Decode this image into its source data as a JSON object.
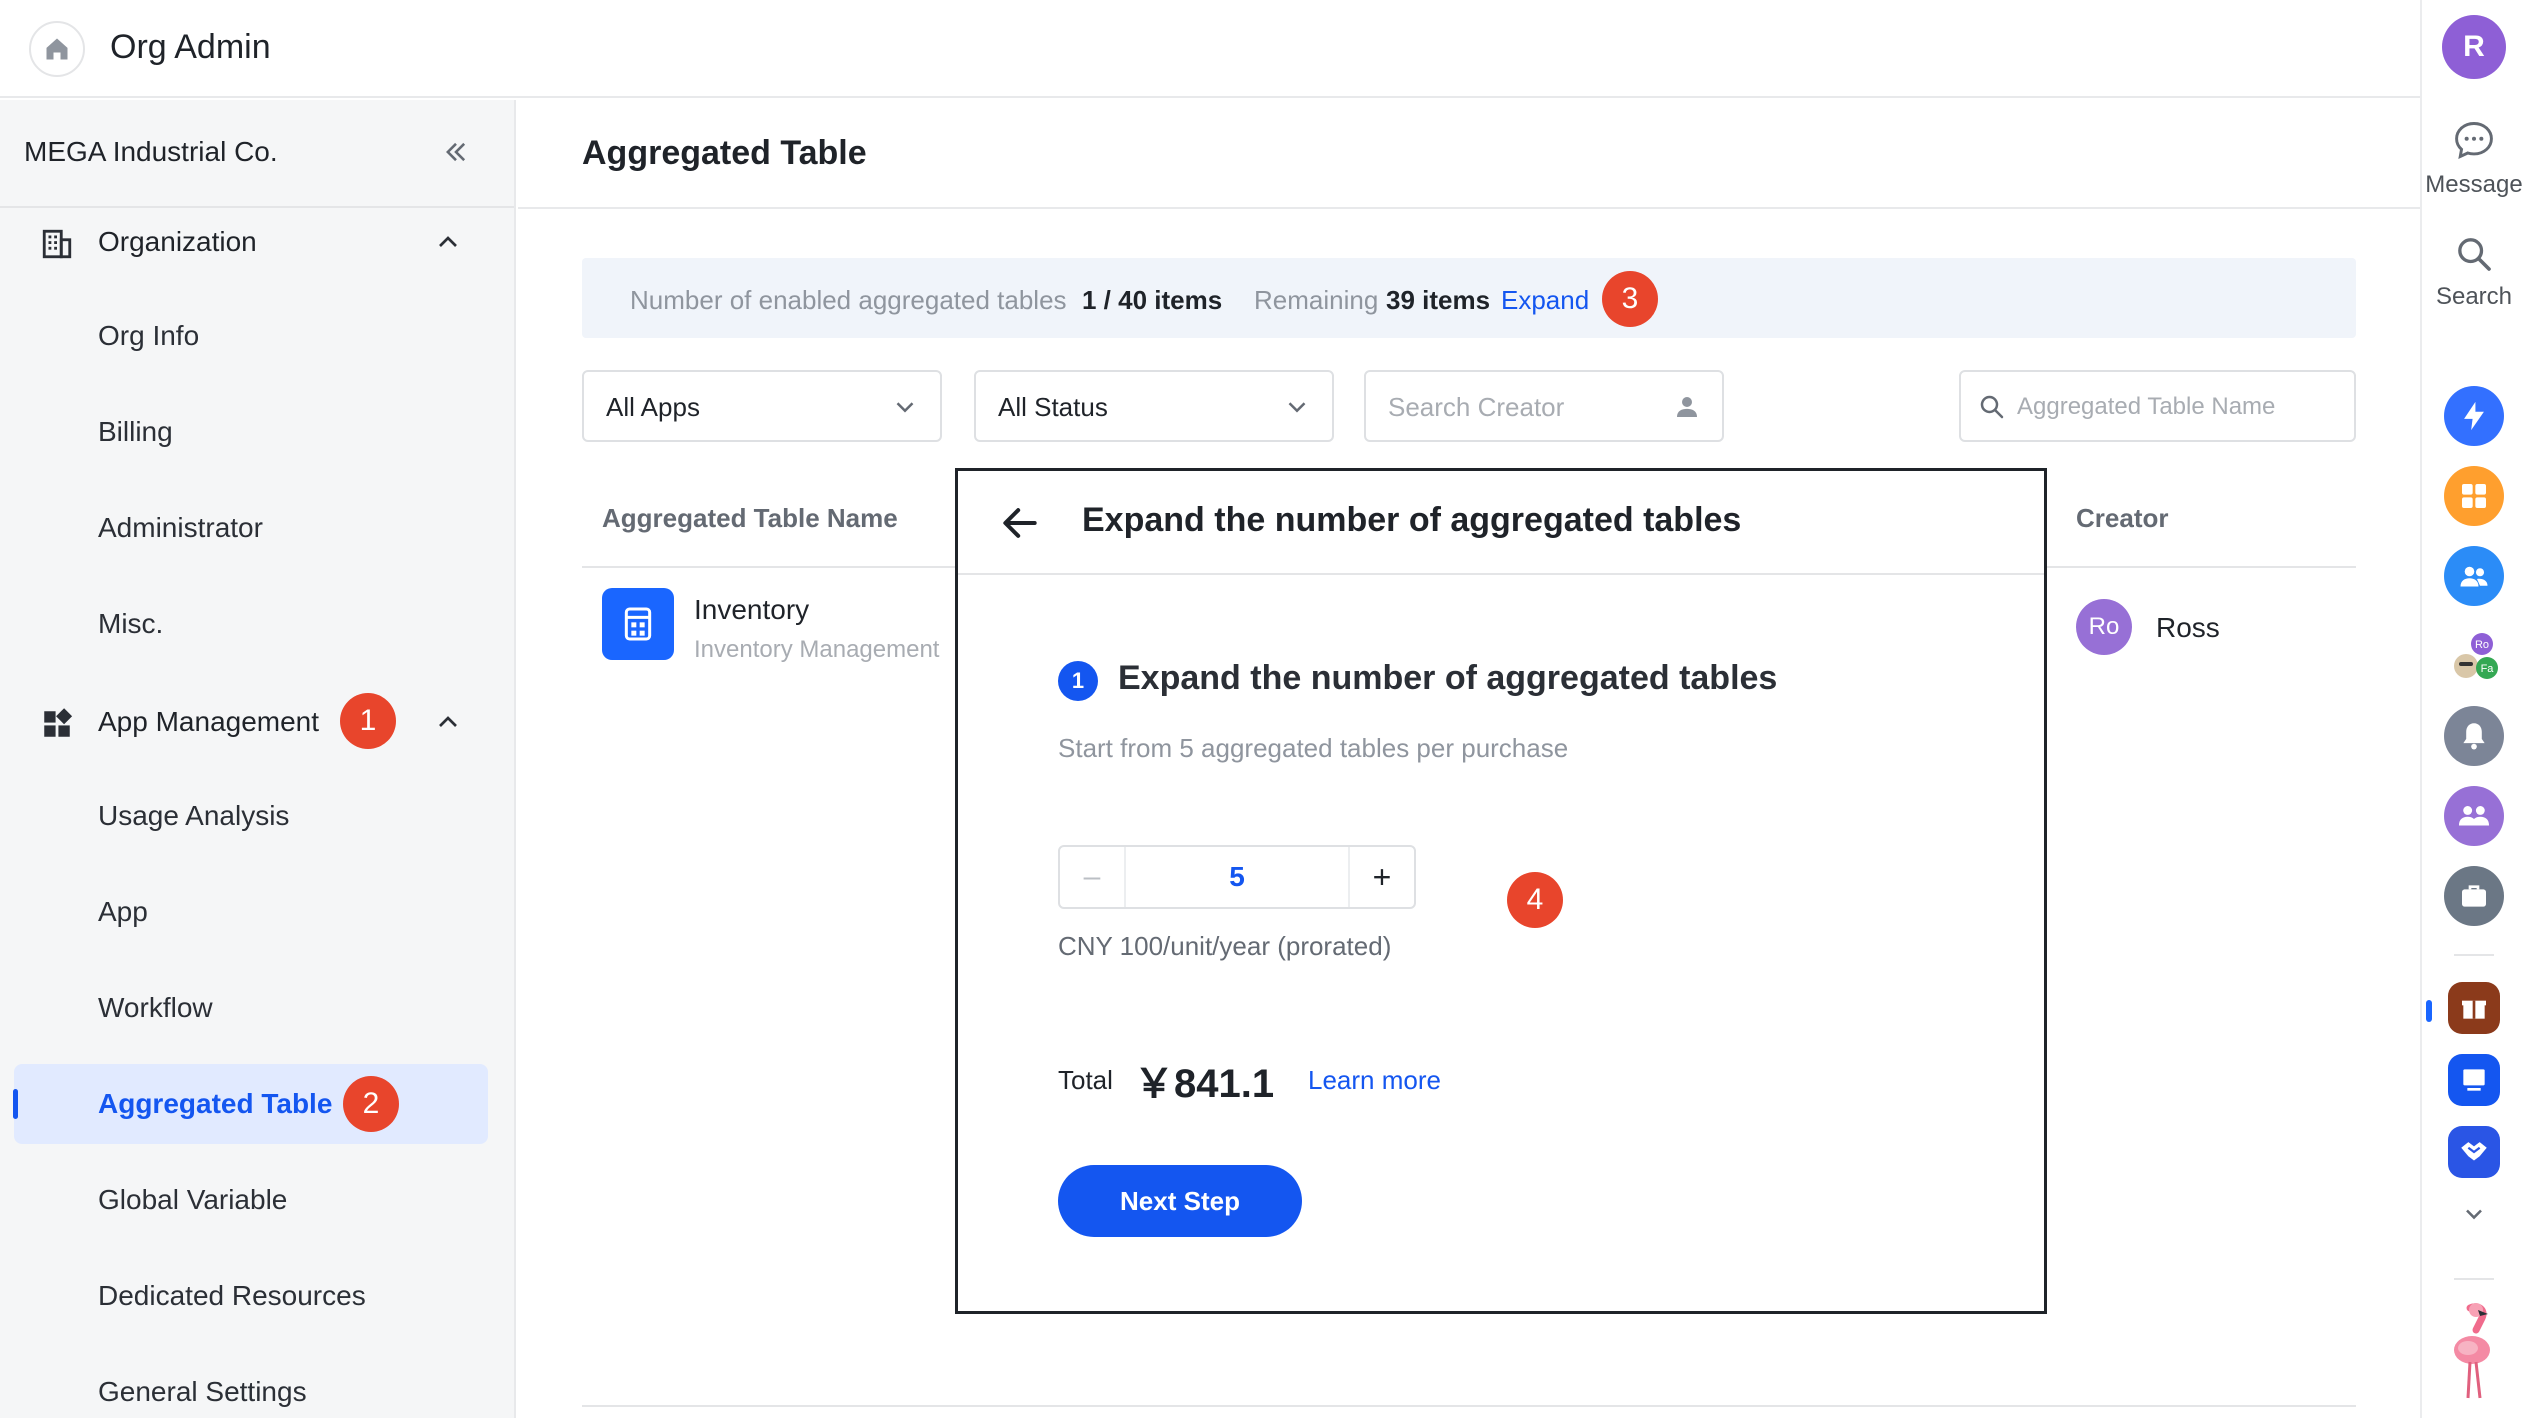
{
  "header": {
    "title": "Org Admin"
  },
  "rail": {
    "avatar": "R",
    "tools": [
      {
        "label": "Message"
      },
      {
        "label": "Search"
      }
    ],
    "badge_names": [
      "Ro",
      "Fa"
    ]
  },
  "sidebar": {
    "org_name": "MEGA Industrial Co.",
    "organization": {
      "label": "Organization",
      "items": [
        "Org Info",
        "Billing",
        "Administrator",
        "Misc."
      ]
    },
    "app_management": {
      "label": "App Management",
      "items": [
        "Usage Analysis",
        "App",
        "Workflow",
        "Aggregated Table",
        "Global Variable",
        "Dedicated Resources",
        "General Settings"
      ],
      "active": "Aggregated Table"
    }
  },
  "main": {
    "title": "Aggregated Table",
    "banner": {
      "enabled_label": "Number of enabled aggregated tables",
      "enabled_value": "1 / 40 items",
      "remaining_label": "Remaining",
      "remaining_value": "39 items",
      "expand_link": "Expand"
    },
    "filters": {
      "apps": "All Apps",
      "status": "All Status",
      "creator_placeholder": "Search Creator",
      "name_placeholder": "Aggregated Table Name"
    },
    "table": {
      "columns": {
        "name": "Aggregated Table Name",
        "creator": "Creator"
      },
      "rows": [
        {
          "name": "Inventory",
          "app": "Inventory Management",
          "creator_initials": "Ro",
          "creator": "Ross"
        }
      ]
    }
  },
  "dialog": {
    "title": "Expand the number of aggregated tables",
    "step_number": "1",
    "step_title": "Expand the number of aggregated tables",
    "step_desc": "Start from 5 aggregated tables per purchase",
    "quantity": "5",
    "minus": "–",
    "plus": "+",
    "price_note": "CNY 100/unit/year (prorated)",
    "total_label": "Total",
    "total_value": "￥841.1",
    "learn_more": "Learn more",
    "next_button": "Next Step"
  },
  "annotations": [
    "1",
    "2",
    "3",
    "4"
  ],
  "colors": {
    "primary": "#1456f0",
    "badge": "#e8452c",
    "sidebar_bg": "#f5f6f7",
    "active_bg": "#e1eaff"
  }
}
